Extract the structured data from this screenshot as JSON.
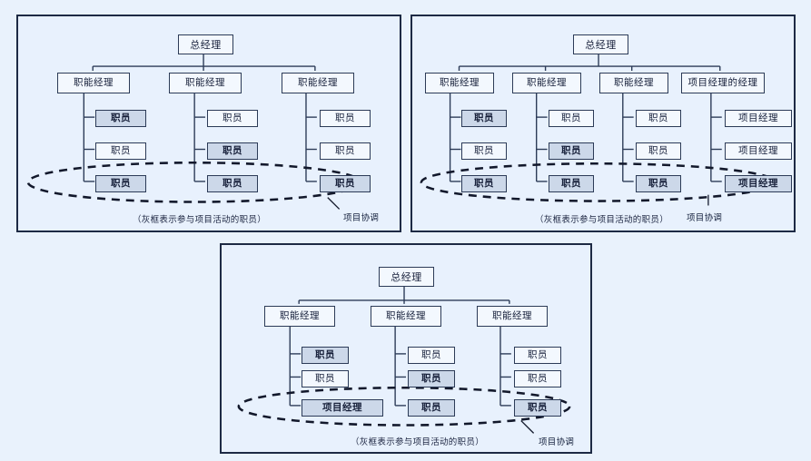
{
  "diagram": {
    "title_text": "",
    "colors": {
      "page_background": "#e9f2fc",
      "panel_background": "#e8f1fd",
      "panel_border": "#1d2a44",
      "node_border": "#2c3b57",
      "node_fill": "#f3f8fe",
      "node_fill_shaded": "#ccd8e9",
      "wire": "#2c3b57",
      "ellipse_dashed": "#12182b",
      "text": "#17203a"
    },
    "legend_note": "（灰框表示参与项目活动的职员）",
    "coordination_label": "项目协调"
  },
  "panels": [
    {
      "id": "functional-organization",
      "top_node": {
        "label": "总经理",
        "shaded": false
      },
      "caption": "（灰框表示参与项目活动的职员）",
      "annotation": "项目协调",
      "columns": [
        {
          "manager": {
            "label": "职能经理",
            "shaded": false
          },
          "staff": [
            {
              "label": "职员",
              "shaded": true
            },
            {
              "label": "职员",
              "shaded": false
            },
            {
              "label": "职员",
              "shaded": true
            }
          ]
        },
        {
          "manager": {
            "label": "职能经理",
            "shaded": false
          },
          "staff": [
            {
              "label": "职员",
              "shaded": false
            },
            {
              "label": "职员",
              "shaded": true
            },
            {
              "label": "职员",
              "shaded": true
            }
          ]
        },
        {
          "manager": {
            "label": "职能经理",
            "shaded": false
          },
          "staff": [
            {
              "label": "职员",
              "shaded": false
            },
            {
              "label": "职员",
              "shaded": false
            },
            {
              "label": "职员",
              "shaded": true
            }
          ]
        }
      ]
    },
    {
      "id": "matrix-organization",
      "top_node": {
        "label": "总经理",
        "shaded": false
      },
      "caption": "（灰框表示参与项目活动的职员）",
      "annotation": "项目协调",
      "columns": [
        {
          "manager": {
            "label": "职能经理",
            "shaded": false
          },
          "staff": [
            {
              "label": "职员",
              "shaded": true
            },
            {
              "label": "职员",
              "shaded": false
            },
            {
              "label": "职员",
              "shaded": true
            }
          ]
        },
        {
          "manager": {
            "label": "职能经理",
            "shaded": false
          },
          "staff": [
            {
              "label": "职员",
              "shaded": false
            },
            {
              "label": "职员",
              "shaded": true
            },
            {
              "label": "职员",
              "shaded": true
            }
          ]
        },
        {
          "manager": {
            "label": "职能经理",
            "shaded": false
          },
          "staff": [
            {
              "label": "职员",
              "shaded": false
            },
            {
              "label": "职员",
              "shaded": false
            },
            {
              "label": "职员",
              "shaded": true
            }
          ]
        },
        {
          "manager": {
            "label": "项目经理的经理",
            "shaded": false
          },
          "staff": [
            {
              "label": "项目经理",
              "shaded": false
            },
            {
              "label": "项目经理",
              "shaded": false
            },
            {
              "label": "项目经理",
              "shaded": true
            }
          ]
        }
      ]
    },
    {
      "id": "weak-matrix-organization",
      "top_node": {
        "label": "总经理",
        "shaded": false
      },
      "caption": "（灰框表示参与项目活动的职员）",
      "annotation": "项目协调",
      "columns": [
        {
          "manager": {
            "label": "职能经理",
            "shaded": false
          },
          "staff": [
            {
              "label": "职员",
              "shaded": true
            },
            {
              "label": "职员",
              "shaded": false
            },
            {
              "label": "项目经理",
              "shaded": true
            }
          ]
        },
        {
          "manager": {
            "label": "职能经理",
            "shaded": false
          },
          "staff": [
            {
              "label": "职员",
              "shaded": false
            },
            {
              "label": "职员",
              "shaded": true
            },
            {
              "label": "职员",
              "shaded": true
            }
          ]
        },
        {
          "manager": {
            "label": "职能经理",
            "shaded": false
          },
          "staff": [
            {
              "label": "职员",
              "shaded": false
            },
            {
              "label": "职员",
              "shaded": false
            },
            {
              "label": "职员",
              "shaded": true
            }
          ]
        }
      ]
    }
  ]
}
